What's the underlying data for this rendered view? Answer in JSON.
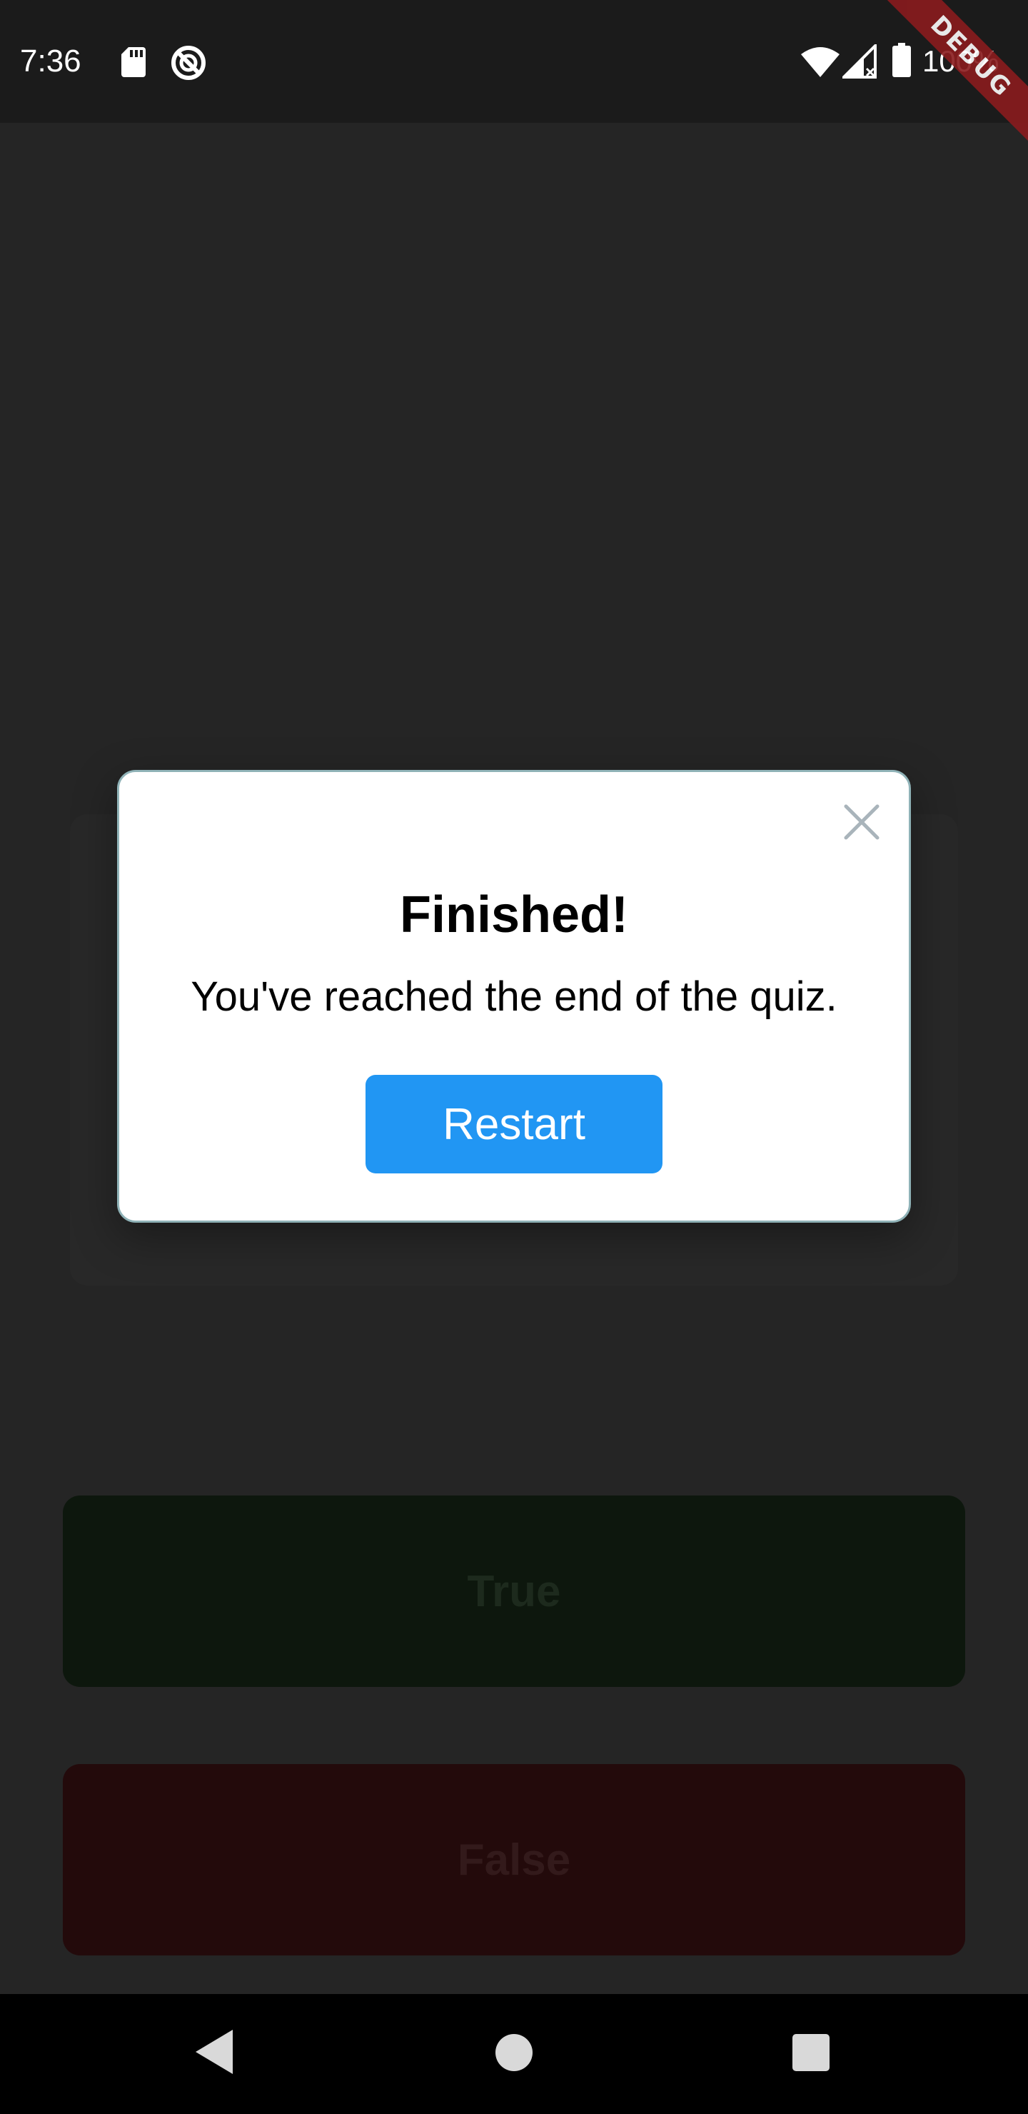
{
  "status_bar": {
    "time": "7:36",
    "battery": "100%",
    "debug_banner": "DEBUG",
    "icons": [
      "sd-card-icon",
      "do-not-disturb-icon",
      "wifi-icon",
      "signal-icon",
      "battery-icon"
    ]
  },
  "quiz": {
    "true_label": "True",
    "false_label": "False"
  },
  "dialog": {
    "title": "Finished!",
    "message": "You've reached the end of the quiz.",
    "restart_label": "Restart",
    "close_icon": "close-icon"
  },
  "nav_bar": {
    "icons": [
      "back-icon",
      "home-icon",
      "recents-icon"
    ]
  },
  "colors": {
    "restart_button": "#2196f3",
    "dialog_border": "#8fb2b7",
    "debug_banner": "#8a1b1e",
    "true_button": "#0d170d",
    "false_button": "#230a0b",
    "background": "#252525"
  }
}
